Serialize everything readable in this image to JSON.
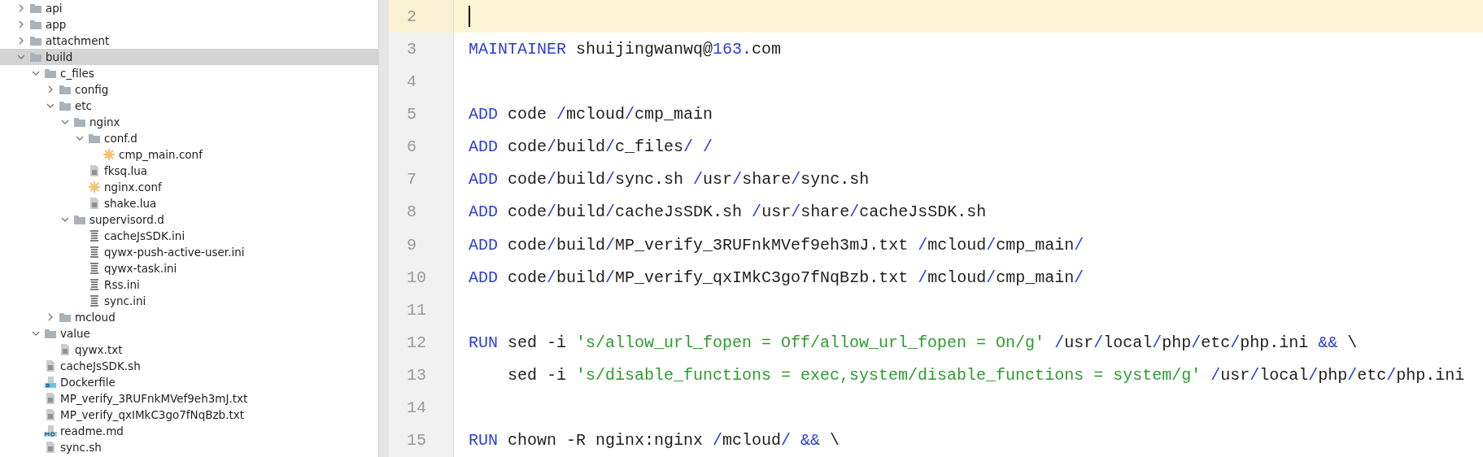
{
  "project_tree": {
    "items": [
      {
        "label": "api",
        "kind": "folder",
        "expanded": false,
        "selected": false
      },
      {
        "label": "app",
        "kind": "folder",
        "expanded": false,
        "selected": false
      },
      {
        "label": "attachment",
        "kind": "folder",
        "expanded": false,
        "selected": false
      },
      {
        "label": "build",
        "kind": "folder",
        "expanded": true,
        "selected": true,
        "children": [
          {
            "label": "c_files",
            "kind": "folder",
            "expanded": true,
            "selected": false,
            "children": [
              {
                "label": "config",
                "kind": "folder",
                "expanded": false,
                "selected": false
              },
              {
                "label": "etc",
                "kind": "folder",
                "expanded": true,
                "selected": false,
                "children": [
                  {
                    "label": "nginx",
                    "kind": "folder",
                    "expanded": true,
                    "selected": false,
                    "children": [
                      {
                        "label": "conf.d",
                        "kind": "folder",
                        "expanded": true,
                        "selected": false,
                        "children": [
                          {
                            "label": "cmp_main.conf",
                            "kind": "conf",
                            "selected": false
                          }
                        ]
                      },
                      {
                        "label": "fksq.lua",
                        "kind": "file",
                        "selected": false
                      },
                      {
                        "label": "nginx.conf",
                        "kind": "conf",
                        "selected": false
                      },
                      {
                        "label": "shake.lua",
                        "kind": "file",
                        "selected": false
                      }
                    ]
                  },
                  {
                    "label": "supervisord.d",
                    "kind": "folder",
                    "expanded": true,
                    "selected": false,
                    "children": [
                      {
                        "label": "cacheJsSDK.ini",
                        "kind": "ini",
                        "selected": false
                      },
                      {
                        "label": "qywx-push-active-user.ini",
                        "kind": "ini",
                        "selected": false
                      },
                      {
                        "label": "qywx-task.ini",
                        "kind": "ini",
                        "selected": false
                      },
                      {
                        "label": "Rss.ini",
                        "kind": "ini",
                        "selected": false
                      },
                      {
                        "label": "sync.ini",
                        "kind": "ini",
                        "selected": false
                      }
                    ]
                  }
                ]
              },
              {
                "label": "mcloud",
                "kind": "folder",
                "expanded": false,
                "selected": false
              }
            ]
          },
          {
            "label": "value",
            "kind": "folder",
            "expanded": true,
            "selected": false,
            "children": [
              {
                "label": "qywx.txt",
                "kind": "file",
                "selected": false
              }
            ]
          },
          {
            "label": "cacheJsSDK.sh",
            "kind": "file",
            "selected": false
          },
          {
            "label": "Dockerfile",
            "kind": "docker",
            "selected": false
          },
          {
            "label": "MP_verify_3RUFnkMVef9eh3mJ.txt",
            "kind": "file",
            "selected": false
          },
          {
            "label": "MP_verify_qxIMkC3go7fNqBzb.txt",
            "kind": "file",
            "selected": false
          },
          {
            "label": "readme.md",
            "kind": "markdown",
            "selected": false
          },
          {
            "label": "sync.sh",
            "kind": "file",
            "selected": false
          }
        ]
      }
    ]
  },
  "editor": {
    "lines": [
      {
        "number": "2",
        "current": true
      },
      {
        "number": "3",
        "current": false,
        "tokens": [
          {
            "kind": "keyword",
            "text": "MAINTAINER"
          },
          {
            "kind": "plain",
            "text": " shuijingwanwq@"
          },
          {
            "kind": "number",
            "text": "163."
          },
          {
            "kind": "plain",
            "text": "com"
          }
        ]
      },
      {
        "number": "4",
        "current": false
      },
      {
        "number": "5",
        "current": false,
        "tokens": [
          {
            "kind": "keyword",
            "text": "ADD"
          },
          {
            "kind": "plain",
            "text": " code "
          },
          {
            "kind": "operator",
            "text": "/"
          },
          {
            "kind": "plain",
            "text": "mcloud"
          },
          {
            "kind": "operator",
            "text": "/"
          },
          {
            "kind": "plain",
            "text": "cmp_main"
          }
        ]
      },
      {
        "number": "6",
        "current": false,
        "tokens": [
          {
            "kind": "keyword",
            "text": "ADD"
          },
          {
            "kind": "plain",
            "text": " code"
          },
          {
            "kind": "operator",
            "text": "/"
          },
          {
            "kind": "plain",
            "text": "build"
          },
          {
            "kind": "operator",
            "text": "/"
          },
          {
            "kind": "plain",
            "text": "c_files"
          },
          {
            "kind": "operator",
            "text": "/ /"
          }
        ]
      },
      {
        "number": "7",
        "current": false,
        "tokens": [
          {
            "kind": "keyword",
            "text": "ADD"
          },
          {
            "kind": "plain",
            "text": " code"
          },
          {
            "kind": "operator",
            "text": "/"
          },
          {
            "kind": "plain",
            "text": "build"
          },
          {
            "kind": "operator",
            "text": "/"
          },
          {
            "kind": "plain",
            "text": "sync.sh "
          },
          {
            "kind": "operator",
            "text": "/"
          },
          {
            "kind": "plain",
            "text": "usr"
          },
          {
            "kind": "operator",
            "text": "/"
          },
          {
            "kind": "plain",
            "text": "share"
          },
          {
            "kind": "operator",
            "text": "/"
          },
          {
            "kind": "plain",
            "text": "sync.sh"
          }
        ]
      },
      {
        "number": "8",
        "current": false,
        "tokens": [
          {
            "kind": "keyword",
            "text": "ADD"
          },
          {
            "kind": "plain",
            "text": " code"
          },
          {
            "kind": "operator",
            "text": "/"
          },
          {
            "kind": "plain",
            "text": "build"
          },
          {
            "kind": "operator",
            "text": "/"
          },
          {
            "kind": "plain",
            "text": "cacheJsSDK.sh "
          },
          {
            "kind": "operator",
            "text": "/"
          },
          {
            "kind": "plain",
            "text": "usr"
          },
          {
            "kind": "operator",
            "text": "/"
          },
          {
            "kind": "plain",
            "text": "share"
          },
          {
            "kind": "operator",
            "text": "/"
          },
          {
            "kind": "plain",
            "text": "cacheJsSDK.sh"
          }
        ]
      },
      {
        "number": "9",
        "current": false,
        "tokens": [
          {
            "kind": "keyword",
            "text": "ADD"
          },
          {
            "kind": "plain",
            "text": " code"
          },
          {
            "kind": "operator",
            "text": "/"
          },
          {
            "kind": "plain",
            "text": "build"
          },
          {
            "kind": "operator",
            "text": "/"
          },
          {
            "kind": "plain",
            "text": "MP_verify_3RUFnkMVef9eh3mJ.txt "
          },
          {
            "kind": "operator",
            "text": "/"
          },
          {
            "kind": "plain",
            "text": "mcloud"
          },
          {
            "kind": "operator",
            "text": "/"
          },
          {
            "kind": "plain",
            "text": "cmp_main"
          },
          {
            "kind": "operator",
            "text": "/"
          }
        ]
      },
      {
        "number": "10",
        "current": false,
        "tokens": [
          {
            "kind": "keyword",
            "text": "ADD"
          },
          {
            "kind": "plain",
            "text": " code"
          },
          {
            "kind": "operator",
            "text": "/"
          },
          {
            "kind": "plain",
            "text": "build"
          },
          {
            "kind": "operator",
            "text": "/"
          },
          {
            "kind": "plain",
            "text": "MP_verify_qxIMkC3go7fNqBzb.txt "
          },
          {
            "kind": "operator",
            "text": "/"
          },
          {
            "kind": "plain",
            "text": "mcloud"
          },
          {
            "kind": "operator",
            "text": "/"
          },
          {
            "kind": "plain",
            "text": "cmp_main"
          },
          {
            "kind": "operator",
            "text": "/"
          }
        ]
      },
      {
        "number": "11",
        "current": false
      },
      {
        "number": "12",
        "current": false,
        "tokens": [
          {
            "kind": "keyword",
            "text": "RUN"
          },
          {
            "kind": "plain",
            "text": " sed -i "
          },
          {
            "kind": "string",
            "text": "'s/allow_url_fopen = Off/allow_url_fopen = On/g'"
          },
          {
            "kind": "operator",
            "text": " /"
          },
          {
            "kind": "plain",
            "text": "usr"
          },
          {
            "kind": "operator",
            "text": "/"
          },
          {
            "kind": "plain",
            "text": "local"
          },
          {
            "kind": "operator",
            "text": "/"
          },
          {
            "kind": "plain",
            "text": "php"
          },
          {
            "kind": "operator",
            "text": "/"
          },
          {
            "kind": "plain",
            "text": "etc"
          },
          {
            "kind": "operator",
            "text": "/"
          },
          {
            "kind": "plain",
            "text": "php.ini "
          },
          {
            "kind": "operator",
            "text": "&&"
          },
          {
            "kind": "plain",
            "text": " \\"
          }
        ]
      },
      {
        "number": "13",
        "current": false,
        "tokens": [
          {
            "kind": "plain",
            "text": "    sed -i "
          },
          {
            "kind": "string",
            "text": "'s/disable_functions = exec,system/disable_functions = system/g'"
          },
          {
            "kind": "operator",
            "text": " /"
          },
          {
            "kind": "plain",
            "text": "usr"
          },
          {
            "kind": "operator",
            "text": "/"
          },
          {
            "kind": "plain",
            "text": "local"
          },
          {
            "kind": "operator",
            "text": "/"
          },
          {
            "kind": "plain",
            "text": "php"
          },
          {
            "kind": "operator",
            "text": "/"
          },
          {
            "kind": "plain",
            "text": "etc"
          },
          {
            "kind": "operator",
            "text": "/"
          },
          {
            "kind": "plain",
            "text": "php.ini"
          }
        ]
      },
      {
        "number": "14",
        "current": false
      },
      {
        "number": "15",
        "current": false,
        "tokens": [
          {
            "kind": "keyword",
            "text": "RUN"
          },
          {
            "kind": "plain",
            "text": " chown -R nginx:nginx "
          },
          {
            "kind": "operator",
            "text": "/"
          },
          {
            "kind": "plain",
            "text": "mcloud"
          },
          {
            "kind": "operator",
            "text": "/ &&"
          },
          {
            "kind": "plain",
            "text": " \\"
          }
        ]
      }
    ]
  }
}
